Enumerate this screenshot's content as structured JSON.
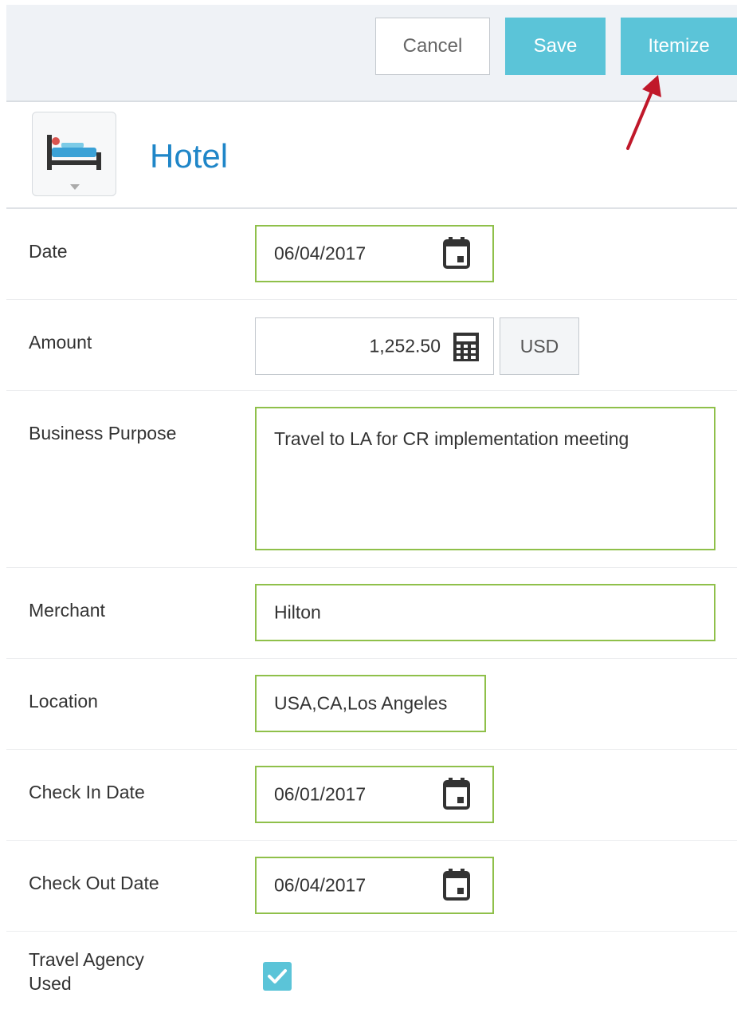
{
  "toolbar": {
    "cancel_label": "Cancel",
    "save_label": "Save",
    "itemize_label": "Itemize"
  },
  "header": {
    "category_icon": "hotel-bed-icon",
    "category_title": "Hotel"
  },
  "form": {
    "date": {
      "label": "Date",
      "value": "06/04/2017"
    },
    "amount": {
      "label": "Amount",
      "value": "1,252.50",
      "currency": "USD"
    },
    "business_purpose": {
      "label": "Business Purpose",
      "value": "Travel to LA for CR implementation meeting"
    },
    "merchant": {
      "label": "Merchant",
      "value": "Hilton"
    },
    "location": {
      "label": "Location",
      "value": "USA,CA,Los Angeles"
    },
    "check_in": {
      "label": "Check In Date",
      "value": "06/01/2017"
    },
    "check_out": {
      "label": "Check Out Date",
      "value": "06/04/2017"
    },
    "travel_agency": {
      "label_line1": "Travel Agency",
      "label_line2": "Used",
      "checked": true
    }
  },
  "colors": {
    "accent": "#5bc4d8",
    "title_blue": "#1f86c8",
    "field_border": "#8fc04a",
    "annotation_arrow": "#c0182a"
  }
}
